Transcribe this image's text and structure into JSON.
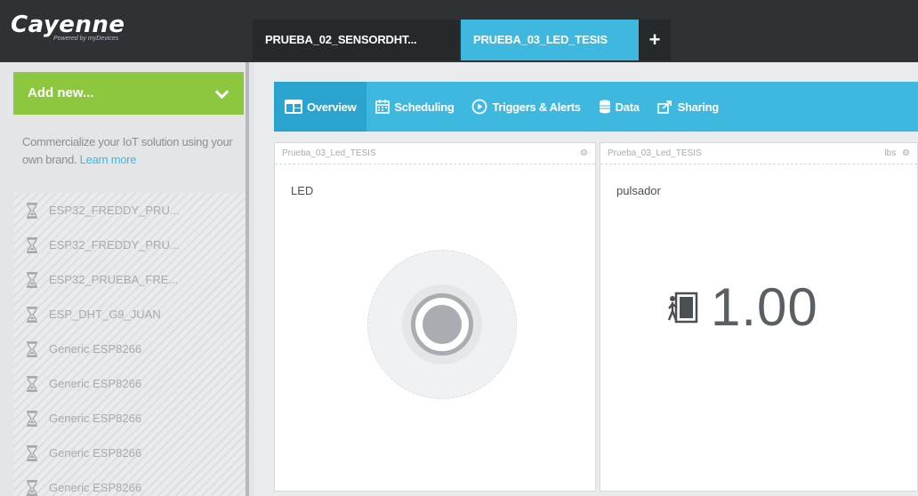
{
  "app": {
    "logo": "Cayenne",
    "logo_sub": "Powered by myDevices"
  },
  "tabs": [
    {
      "label": "PRUEBA_02_SENSORDHT..."
    },
    {
      "label": "PRUEBA_03_LED_TESIS"
    }
  ],
  "add_tab_label": "+",
  "sidebar": {
    "add_new_label": "Add new...",
    "promo_text": "Commercialize your IoT solution using your own brand.",
    "promo_link": "Learn more",
    "devices": [
      {
        "label": "ESP32_FREDDY_PRU..."
      },
      {
        "label": "ESP32_FREDDY_PRU..."
      },
      {
        "label": "ESP32_PRUEBA_FRE..."
      },
      {
        "label": "ESP_DHT_G9_JUAN"
      },
      {
        "label": "Generic ESP8266"
      },
      {
        "label": "Generic ESP8266"
      },
      {
        "label": "Generic ESP8266"
      },
      {
        "label": "Generic ESP8266"
      },
      {
        "label": "Generic ESP8266"
      }
    ]
  },
  "subnav": {
    "overview": "Overview",
    "scheduling": "Scheduling",
    "triggers": "Triggers & Alerts",
    "data": "Data",
    "sharing": "Sharing"
  },
  "widgets": [
    {
      "device": "Prueba_03_Led_TESIS",
      "title": "LED"
    },
    {
      "device": "Prueba_03_Led_TESIS",
      "title": "pulsador",
      "value": "1.00",
      "unit_short": "lbs"
    }
  ],
  "colors": {
    "accent": "#3fb8e0",
    "add_new": "#8dc63f",
    "topbar": "#2f3235"
  }
}
